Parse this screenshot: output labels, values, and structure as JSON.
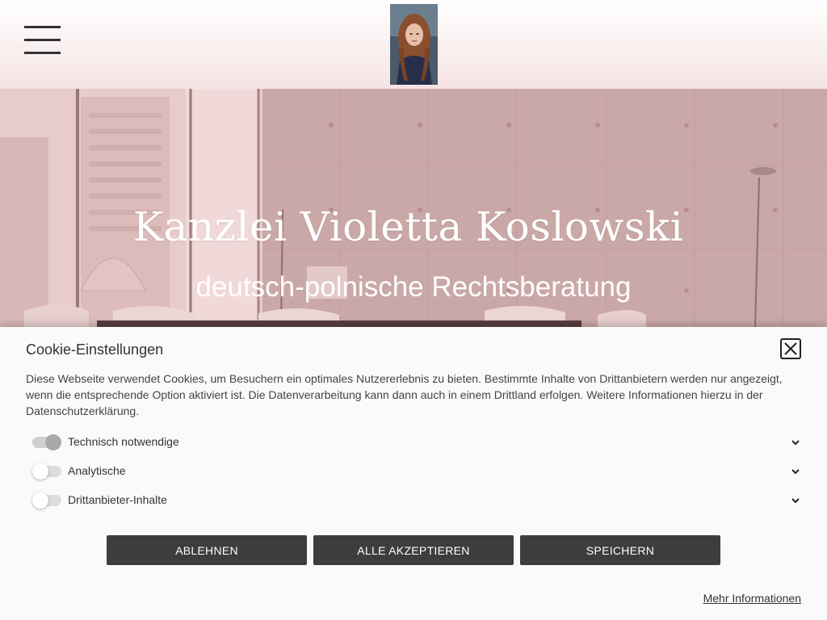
{
  "header": {
    "menu_icon": "hamburger-menu-icon",
    "logo_icon": "portrait-photo"
  },
  "hero": {
    "title": "Kanzlei Violetta Koslowski",
    "subtitle": "deutsch-polnische Rechtsberatung"
  },
  "cookie": {
    "title": "Cookie-Einstellungen",
    "text": "Diese Webseite verwendet Cookies, um Besuchern ein optimales Nutzererlebnis zu bieten. Bestimmte Inhalte von Drittanbietern werden nur angezeigt, wenn die entsprechende Option aktiviert ist. Die Datenverarbeitung kann dann auch in einem Drittland erfolgen. Weitere Informationen hierzu in der Datenschutzerklärung.",
    "options": [
      {
        "label": "Technisch notwendige",
        "enabled": true
      },
      {
        "label": "Analytische",
        "enabled": false
      },
      {
        "label": "Drittanbieter-Inhalte",
        "enabled": false
      }
    ],
    "buttons": {
      "decline": "ABLEHNEN",
      "accept_all": "ALLE AKZEPTIEREN",
      "save": "SPEICHERN"
    },
    "more_info": "Mehr Informationen",
    "close_icon": "close-icon"
  },
  "colors": {
    "header_gradient_end": "#f6e3e4",
    "hero_tint": "#c9a6a5",
    "button_bg": "#3d3d3d",
    "panel_bg": "#fafafa"
  }
}
